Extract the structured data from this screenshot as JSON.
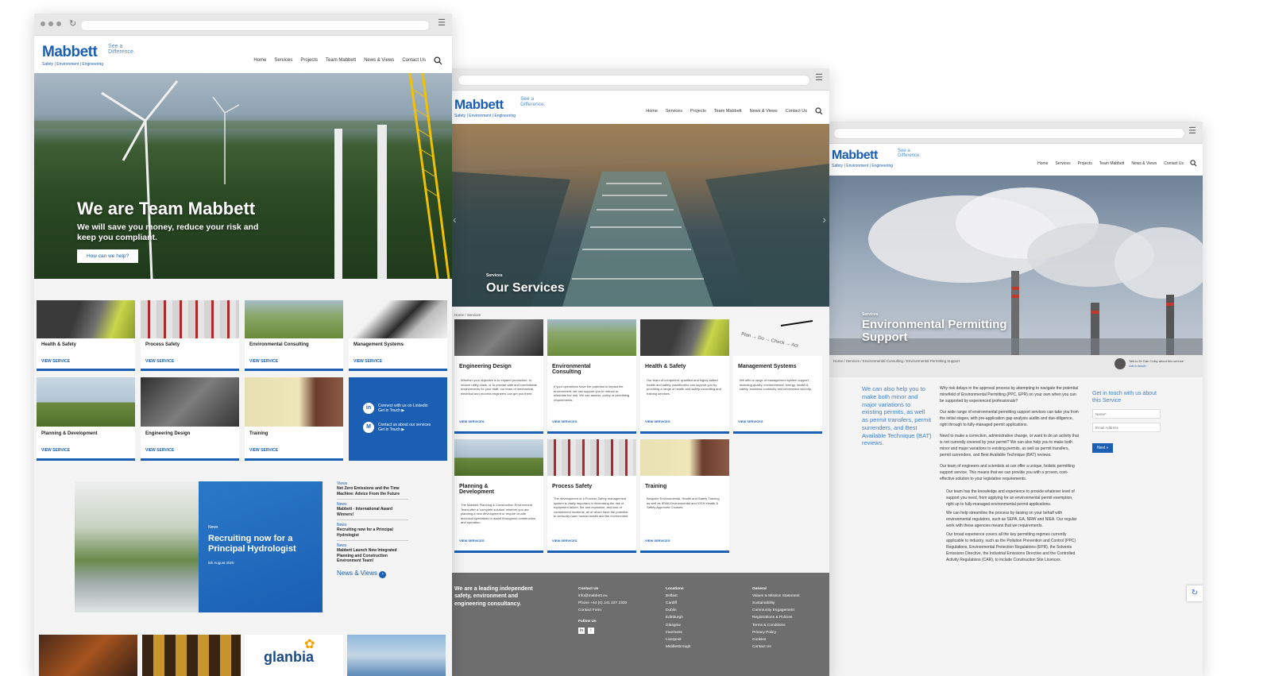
{
  "brand": {
    "name": "Mabbett",
    "subtitle": "Safety | Environment | Engineering",
    "tagline_1": "See a",
    "tagline_2": "Difference."
  },
  "nav": [
    "Home",
    "Services",
    "Projects",
    "Team Mabbett",
    "News & Views",
    "Contact Us"
  ],
  "colors": {
    "brand_blue": "#1a5fb4",
    "footer_grey": "#6e6e6e",
    "page_grey": "#f4f4f4"
  },
  "home": {
    "hero_title": "We are Team Mabbett",
    "hero_subtitle_1": "We will save you money, reduce your risk and",
    "hero_subtitle_2": "keep you compliant.",
    "hero_button": "How can we help?",
    "cards": [
      {
        "title": "Health & Safety",
        "link": "VIEW SERVICE"
      },
      {
        "title": "Process Safety",
        "link": "VIEW SERVICE"
      },
      {
        "title": "Environmental Consulting",
        "link": "VIEW SERVICE"
      },
      {
        "title": "Management Systems",
        "link": "VIEW SERVICE"
      },
      {
        "title": "Planning & Development",
        "link": "VIEW SERVICE"
      },
      {
        "title": "Engineering Design",
        "link": "VIEW SERVICE"
      },
      {
        "title": "Training",
        "link": "VIEW SERVICE"
      }
    ],
    "connect": {
      "linkedin_1": "Connect with us on Linkedin",
      "linkedin_2": "Get in Touch",
      "contact_1": "Contact us about our services",
      "contact_2": "Get in Touch"
    },
    "news_feature": {
      "label": "News",
      "title_1": "Recruiting now for a",
      "title_2": "Principal Hydrologist",
      "date": "5th August 2020"
    },
    "news_list": [
      {
        "label": "Views",
        "title": "Net Zero Emissions and the Time Machine: Advice From the Future"
      },
      {
        "label": "News",
        "title": "Mabbett - International Award Winners!"
      },
      {
        "label": "News",
        "title": "Recruiting now for a Principal Hydrologist"
      },
      {
        "label": "News",
        "title": "Mabbett Launch New Integrated Planning and Construction Environment Team!"
      }
    ],
    "news_link": "News & Views",
    "client_logo": "glanbia"
  },
  "services": {
    "hero_label": "Services",
    "hero_title": "Our Services",
    "breadcrumb": "Home / Services",
    "cards": [
      {
        "title": "Engineering Design",
        "desc": "Whether your objective is to expand production, to reduce utility costs, or to provide safe and comfortable environments for your staff, our team of mechanical, electrical and process engineers can get you there.",
        "link": "VIEW SERVICES"
      },
      {
        "title": "Environmental Consulting",
        "desc": "If your operations have the potential to impact the environment, we can support you to reduce or eliminate the risk. We can assess, policy or permitting requirements.",
        "link": "VIEW SERVICES"
      },
      {
        "title": "Health & Safety",
        "desc": "Our team of competent, qualified and highly skilled health and safety practitioners can support you by providing a range of health and safety consulting and training services.",
        "link": "VIEW SERVICES"
      },
      {
        "title": "Management Systems",
        "desc": "We offer a range of management system support, including quality, environmental, energy, health & safety, business continuity and information security.",
        "link": "VIEW SERVICES"
      },
      {
        "title": "Planning & Development",
        "desc": "The Mabbett Planning & Construction Environment Team offer a 'complete solution' whether you are planning a new development or require on-site technical specialists to assist throughout construction and operation.",
        "link": "VIEW SERVICES"
      },
      {
        "title": "Process Safety",
        "desc": "The development of a Process Safety management system is vitally important in minimising the risk of equipment failure, fire and explosion, and loss of containment incidents, all of which have the potential to seriously harm human health and the environment.",
        "link": "VIEW SERVICES"
      },
      {
        "title": "Training",
        "desc": "Bespoke Environmental, Health and Safety Training as well as IEMA Environmental and IOSH Health & Safety Approved Courses.",
        "link": "VIEW SERVICES"
      }
    ],
    "footer": {
      "about": "We are a leading independent safety, environment and engineering consultancy.",
      "contact_head": "Contact Us",
      "contact": [
        "info@mabbett.eu",
        "Phone +44 (0) 141 227 2300",
        "Contact Form"
      ],
      "follow": "Follow Us",
      "locations_head": "Locations",
      "locations": [
        "Belfast",
        "Cardiff",
        "Dublin",
        "Edinburgh",
        "Glasgow",
        "Inverness",
        "Liverpool",
        "Middlesbrough"
      ],
      "general_head": "General",
      "general": [
        "Values & Mission Statement",
        "Sustainability",
        "Community Engagement",
        "Registrations & Policies",
        "Terms & Conditions",
        "Privacy Policy",
        "Cookies",
        "Contact Us"
      ]
    }
  },
  "permitting": {
    "hero_label": "Services",
    "hero_title_1": "Environmental Permitting",
    "hero_title_2": "Support",
    "breadcrumb": "Home / Services / Environmental Consulting / Environmental Permitting Support",
    "talk_1": "Talk to Dr Dan Colby about this service",
    "talk_2": "Get in touch",
    "lead": "We can also help you to make both minor and major variations to existing permits, as well as permit transfers, permit surrenders, and Best Available Technique (BAT) reviews.",
    "paragraphs": [
      "Why risk delays in the approval process by attempting to navigate the potential minefield of Environmental Permitting (PPC, EPR) on your own when you can be supported by experienced professionals?",
      "Our wide range of environmental permitting support services can take you from the initial stages, with pre-application gap analysis audits and due-diligence, right through to fully-managed permit applications.",
      "Need to make a correction, administrative change, or want to do an activity that is not currently covered by your permit? We can also help you to make both minor and major variations to existing permits, as well as permit transfers, permit surrenders, and Best Available Technique (BAT) reviews.",
      "Our team of engineers and scientists at can offer a unique, holistic permitting support service. This means that we can provide you with a proven, cost-effective solution to your legislative requirements."
    ],
    "bullets": [
      "Our team has the knowledge and experience to provide whatever level of support you need, from applying for an environmental permit exemption, right up to fully-managed environmental permit applications.",
      "We can help streamline the process by liaising on your behalf with environmental regulators, such as SEPA, EA, NRW and NIEA. Our regular work with these agencies means that we requirements.",
      "Our broad experience covers all the key permitting regimes currently applicable to industry, such as the Pollution Prevention and Control (PPC) Regulations, Environmental Protection Regulations (EPR), the Solvents Emissions Directive, the Industrial Emissions Directive and the Controlled Activity Regulations (CAR), to include Construction Site Licences."
    ],
    "form": {
      "heading": "Get in touch with us about this Service",
      "name_placeholder": "Name*",
      "email_placeholder": "Email Address",
      "button": "Next »"
    }
  }
}
